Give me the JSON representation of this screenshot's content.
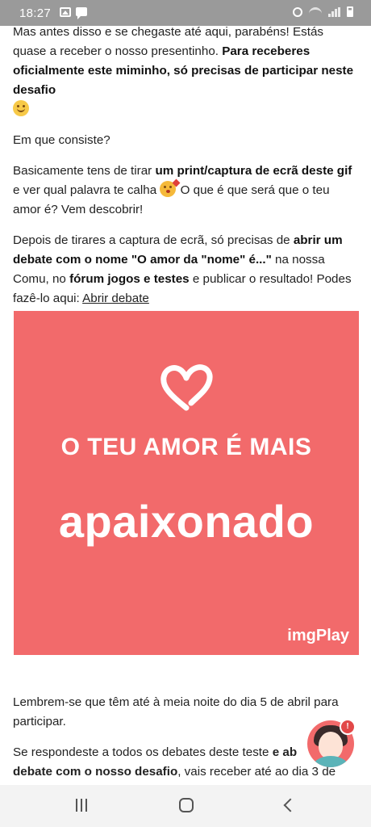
{
  "status_bar": {
    "time": "18:27",
    "icons_left": [
      "image-icon",
      "chat-icon"
    ],
    "icons_right": [
      "alarm-icon",
      "wifi-icon",
      "signal-icon",
      "battery-icon"
    ]
  },
  "post": {
    "p1_a": "Mas antes disso e se chegaste até aqui, parabéns! Estás quase a receber o nosso presentinho. ",
    "p1_bold": "Para receberes oficialmente este miminho, só precisas de participar neste desafio",
    "p2": "Em que consiste?",
    "p3_a": "Basicamente tens de tirar ",
    "p3_bold": "um print/captura de ecrã deste gif",
    "p3_b": " e ver qual palavra te calha ",
    "p3_c": " O que é que será que o teu amor é? Vem descobrir!",
    "p4_a": "Depois de tirares a captura de ecrã, só precisas de ",
    "p4_bold1": "abrir um debate com o nome \"O amor da \"nome\" é...\"",
    "p4_b": " na nossa Comu, no ",
    "p4_bold2": "fórum jogos e testes",
    "p4_c": " e publicar o resultado! Podes fazê-lo aqui: ",
    "p4_link": "Abrir debate",
    "p5": "Lembrem-se que têm até à meia noite do dia 5 de abril para participar.",
    "p6_a": "Se respondeste a todos os debates deste teste ",
    "p6_bold1": "e ab",
    "p6_bold2": "debate com o nosso desafio",
    "p6_b": ", vais receber até ao dia 3 de"
  },
  "gif": {
    "line1": "O TEU AMOR É MAIS",
    "line2": "apaixonado",
    "brand": "imgPlay",
    "background": "#f26a6b"
  },
  "fab": {
    "badge": "!"
  },
  "nav": {
    "icons": [
      "recents-icon",
      "home-icon",
      "back-icon"
    ]
  }
}
